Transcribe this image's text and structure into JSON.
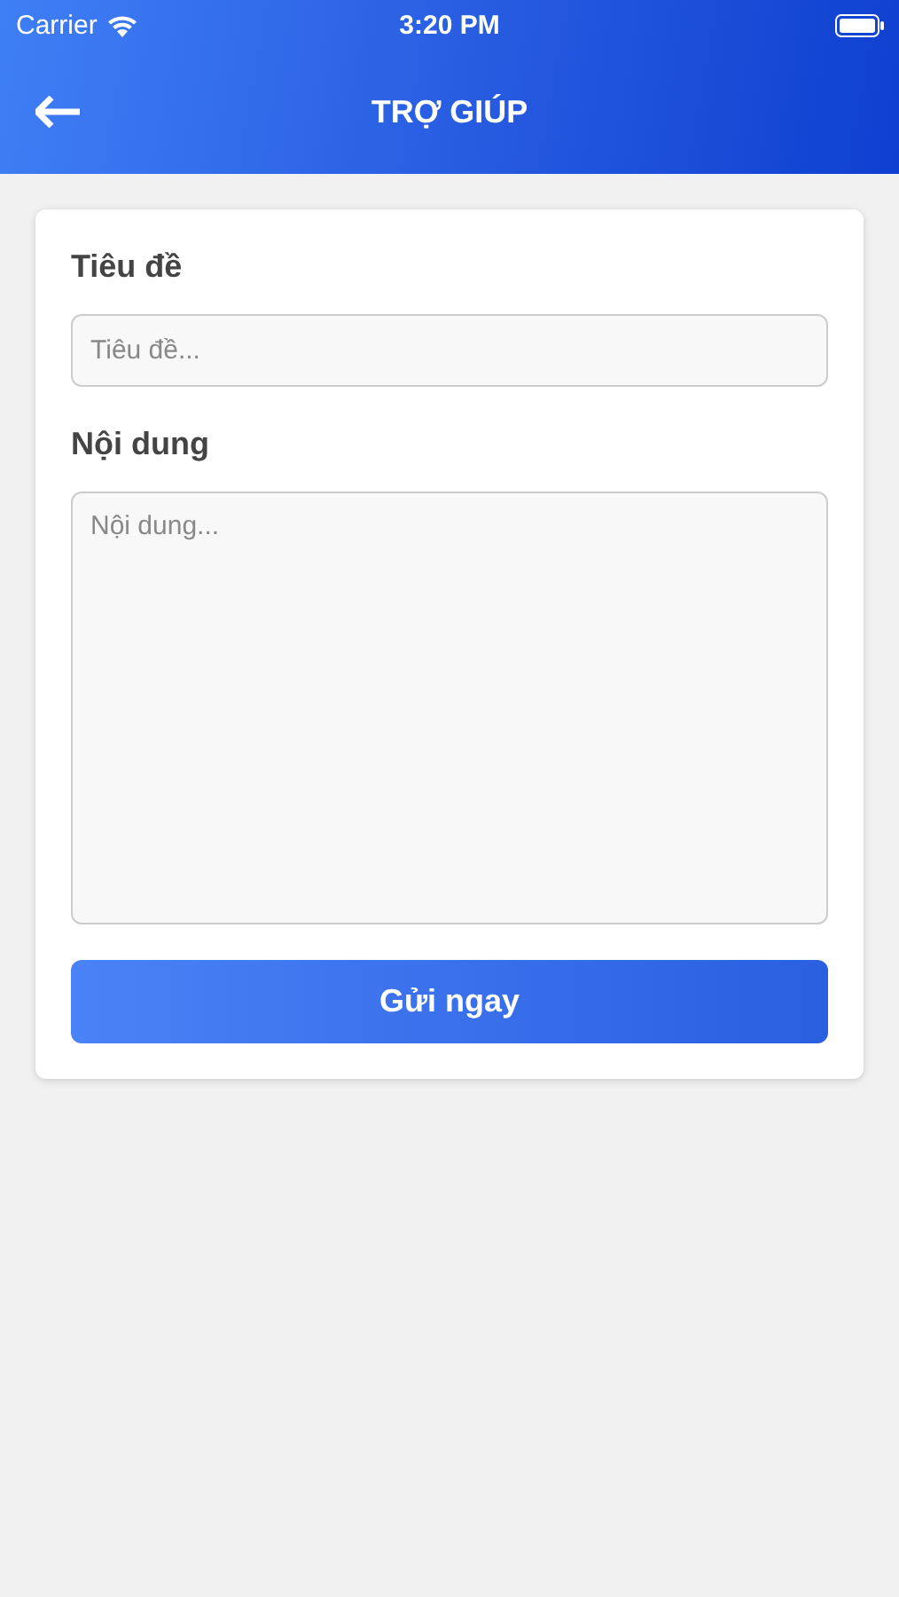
{
  "status_bar": {
    "carrier": "Carrier",
    "time": "3:20 PM"
  },
  "header": {
    "title": "TRỢ GIÚP"
  },
  "form": {
    "fields": [
      {
        "kind": "input",
        "label": "Tiêu đề",
        "placeholder": "Tiêu đề..."
      },
      {
        "kind": "textarea",
        "label": "Nội dung",
        "placeholder": "Nội dung..."
      }
    ],
    "submit": "Gửi ngay"
  }
}
